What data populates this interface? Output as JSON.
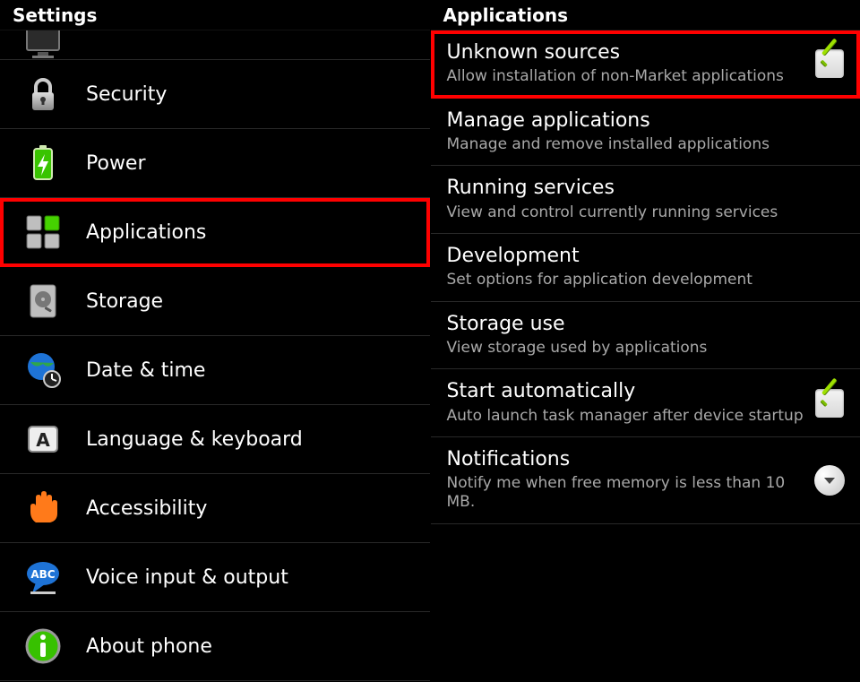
{
  "left": {
    "header": "Settings",
    "items": [
      {
        "label": ""
      },
      {
        "label": "Security"
      },
      {
        "label": "Power"
      },
      {
        "label": "Applications"
      },
      {
        "label": "Storage"
      },
      {
        "label": "Date & time"
      },
      {
        "label": "Language & keyboard"
      },
      {
        "label": "Accessibility"
      },
      {
        "label": "Voice input & output"
      },
      {
        "label": "About phone"
      }
    ]
  },
  "right": {
    "header": "Applications",
    "items": [
      {
        "title": "Unknown sources",
        "sub": "Allow installation of non-Market applications"
      },
      {
        "title": "Manage applications",
        "sub": "Manage and remove installed applications"
      },
      {
        "title": "Running services",
        "sub": "View and control currently running services"
      },
      {
        "title": "Development",
        "sub": "Set options for application development"
      },
      {
        "title": "Storage use",
        "sub": "View storage used by applications"
      },
      {
        "title": "Start automatically",
        "sub": "Auto launch task manager after device startup"
      },
      {
        "title": "Notifications",
        "sub": "Notify me when free memory is less than 10 MB."
      }
    ]
  }
}
